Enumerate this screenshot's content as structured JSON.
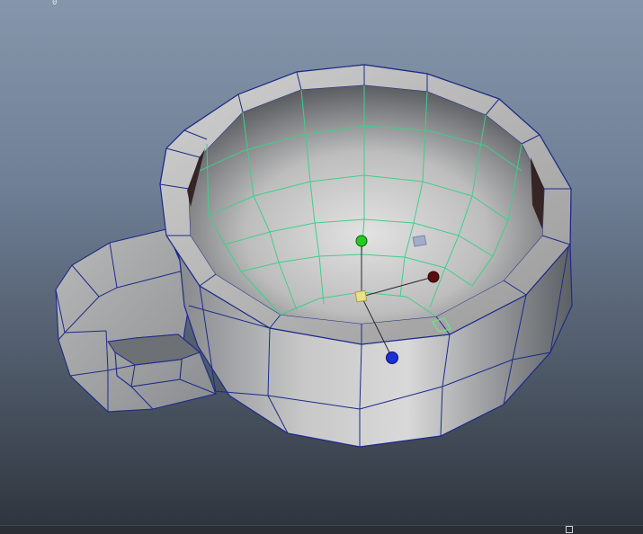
{
  "viewport": {
    "corner_readout": "0",
    "background_top_color": "#8596ab",
    "background_bottom_color": "#2e343c"
  },
  "mesh": {
    "wireframe_color": "#1d2a8a",
    "selected_edge_color": "#3fcf8a",
    "shading_light": "#e2e2e2",
    "shading_dark": "#555a5f"
  },
  "manipulator": {
    "x_axis_color": "#5a0e0e",
    "y_axis_color": "#22cc22",
    "z_axis_color": "#1f2fd8",
    "center_color": "#e8e08a",
    "plane_xy_color": "#9aa7c8",
    "plane_xz_color": "#6ee08a"
  }
}
